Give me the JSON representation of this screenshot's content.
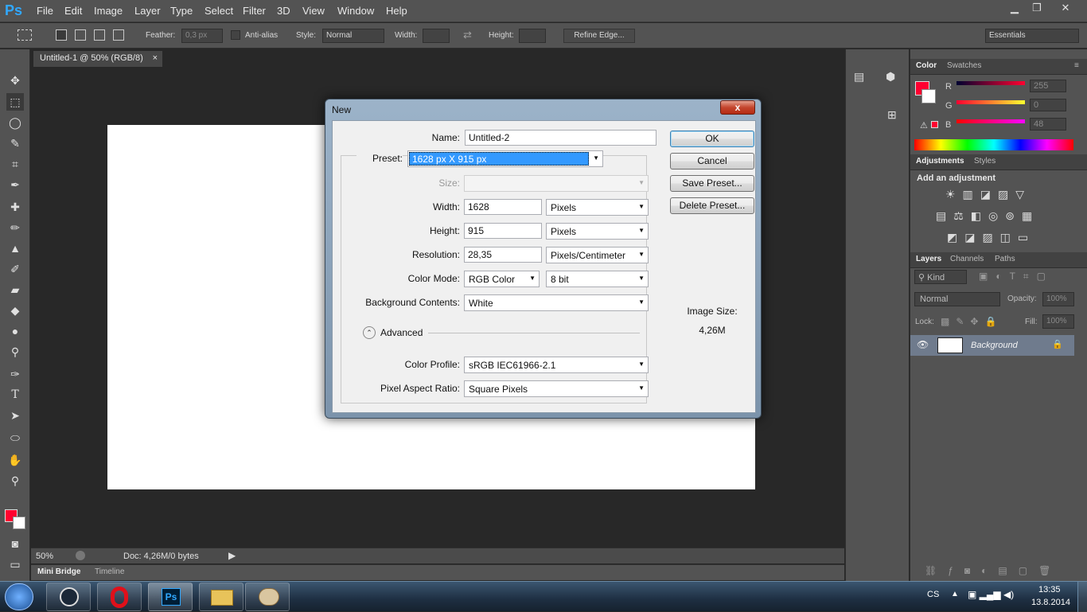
{
  "app": {
    "logo": "Ps"
  },
  "menu": [
    "File",
    "Edit",
    "Image",
    "Layer",
    "Type",
    "Select",
    "Filter",
    "3D",
    "View",
    "Window",
    "Help"
  ],
  "options_bar": {
    "feather_label": "Feather:",
    "feather_value": "0,3 px",
    "antialias_label": "Anti-alias",
    "style_label": "Style:",
    "style_value": "Normal",
    "width_label": "Width:",
    "height_label": "Height:",
    "refine_edge": "Refine Edge...",
    "workspace": "Essentials"
  },
  "document": {
    "tab_title": "Untitled-1 @ 50% (RGB/8)",
    "tab_close": "×",
    "zoom": "50%",
    "doc_info": "Doc: 4,26M/0 bytes"
  },
  "bottom_tabs": [
    "Mini Bridge",
    "Timeline"
  ],
  "color_panel": {
    "tabs": [
      "Color",
      "Swatches"
    ],
    "r_label": "R",
    "g_label": "G",
    "b_label": "B",
    "r_value": "255",
    "g_value": "0",
    "b_value": "48",
    "foreground_color": "#ff0030"
  },
  "adjustments_panel": {
    "tabs": [
      "Adjustments",
      "Styles"
    ],
    "heading": "Add an adjustment"
  },
  "layers_panel": {
    "tabs": [
      "Layers",
      "Channels",
      "Paths"
    ],
    "kind": "Kind",
    "blend_mode": "Normal",
    "opacity_label": "Opacity:",
    "opacity_value": "100%",
    "lock_label": "Lock:",
    "fill_label": "Fill:",
    "fill_value": "100%",
    "layer_name": "Background"
  },
  "dialog": {
    "title": "New",
    "close": "x",
    "name_label": "Name:",
    "name_value": "Untitled-2",
    "preset_label": "Preset:",
    "preset_value": "1628 px X 915 px",
    "size_label": "Size:",
    "width_label": "Width:",
    "width_value": "1628",
    "width_unit": "Pixels",
    "height_label": "Height:",
    "height_value": "915",
    "height_unit": "Pixels",
    "resolution_label": "Resolution:",
    "resolution_value": "28,35",
    "resolution_unit": "Pixels/Centimeter",
    "color_mode_label": "Color Mode:",
    "color_mode_value": "RGB Color",
    "bit_depth": "8 bit",
    "background_label": "Background Contents:",
    "background_value": "White",
    "advanced_label": "Advanced",
    "color_profile_label": "Color Profile:",
    "color_profile_value": "sRGB IEC61966-2.1",
    "pixel_aspect_label": "Pixel Aspect Ratio:",
    "pixel_aspect_value": "Square Pixels",
    "ok": "OK",
    "cancel": "Cancel",
    "save_preset": "Save Preset...",
    "delete_preset": "Delete Preset...",
    "image_size_label": "Image Size:",
    "image_size_value": "4,26M"
  },
  "taskbar": {
    "lang": "CS",
    "time": "13:35",
    "date": "13.8.2014"
  }
}
